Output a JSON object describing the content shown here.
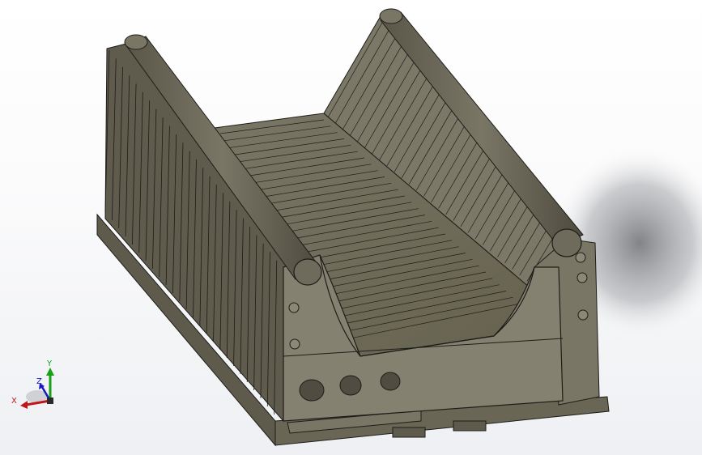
{
  "viewport": {
    "background_top": "#ffffff",
    "background_bottom": "#eef0f3"
  },
  "model": {
    "body_color": "#6e6a5c",
    "face_light": "#8c8878",
    "face_dark": "#504c42",
    "edge_color": "#1e1c18"
  },
  "triad": {
    "x_label": "X",
    "y_label": "Y",
    "z_label": "Z",
    "x_color": "#c01818",
    "y_color": "#18a018",
    "z_color": "#1818c0"
  }
}
